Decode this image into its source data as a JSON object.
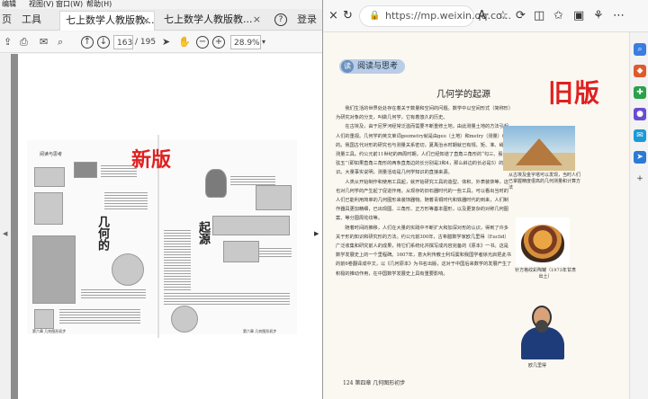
{
  "menu": [
    "编辑",
    "视图(V)",
    "窗口(W)",
    "帮助(H)"
  ],
  "pdf_tabs": {
    "home": "页",
    "tools": "工具",
    "tab1": "七上数学人教版教...",
    "tab2": "七上数学人教版教...",
    "help_icon": "?",
    "login": "登录"
  },
  "pdf_toolbar": {
    "page_current": "163",
    "page_total": "/ 195",
    "zoom": "28.9%"
  },
  "pdf_page": {
    "header_small": "阅读与思考",
    "title_vertical_1": "几何的",
    "title_vertical_2": "起源",
    "label": "新版",
    "footer_left": "第六章  几何图形初步",
    "footer_right": "第六章  几何图形初步"
  },
  "browser": {
    "url": "https://mp.weixin.qq.co...",
    "lock_icon": "lock-icon"
  },
  "book": {
    "badge": "阅读与思考",
    "title": "几何学的起源",
    "label": "旧版",
    "paragraphs": [
      "我们生活的世界处处存在着关于数量和空间的问题。数学中以空间形式（简称形）为研究对象的分支，叫做几何学，它有着悠久的历史。",
      "在古埃及，由于尼罗河经常泛滥而需要不断重修土地，由此测量土地的方法引起人们的重视。几何学的英文单词geometry就是由geo（土地）和metry（测量）组成的。我国古代对形的研究也与测量关系密切，夏禹治水时期就已有规、矩、准、绳等测量工具。约公元前11世纪的西周时期，人们已经知道了直角三角形的“勾三、股四、弦五”（即如果直角三角形的两条直角边的长分别是3和4，那么斜边的长必是5）的知识。大量事实说明，测量活动是几何学知识的直接来源。",
      "人类从开始制作和使用工具起，就开始研究工具的造型、体积、外表装饰等，这也对几何学的产生起了促进作用。从现存的旧石器时代的一些工具，可以看出当时的人们已能利用简单的几何图形来装饰器物。随着青铜时代和铁器时代的到来，人们制作器具更加精细，已出现圆、三角形、正方形等基本图形，以及更复杂的对称几何图案、等分圆周花纹等。",
      "随着时间的推移，人们在大量的实践中不断扩大和加深对形的认识，得到了许多关于形的知识和研究形的方法。约公元前300年，古希腊数学家欧几里得（Euclid）广泛收集和研究前人的成果，将它们系统化并撰写成内容完备的《原本》一书。这是数学发展史上的一个里程碑。1607年，意大利传教士利玛窦和我国学者徐光启把此书的前6卷翻译成中文，以《几何原本》为书名出版，这对于中国后来数学的发展产生了积极的推动作用，在中国数学发展史上具有重要影响。"
    ],
    "cap_pyramid": "从古埃及金字塔可以发现，当时人们已掌握精度很高的几何测量和计算方法",
    "cap_pot": "针方格纹彩陶罐（1973年甘肃出土）",
    "cap_euclid": "欧几里得",
    "footer": "124  第四章  几何图形初步"
  }
}
